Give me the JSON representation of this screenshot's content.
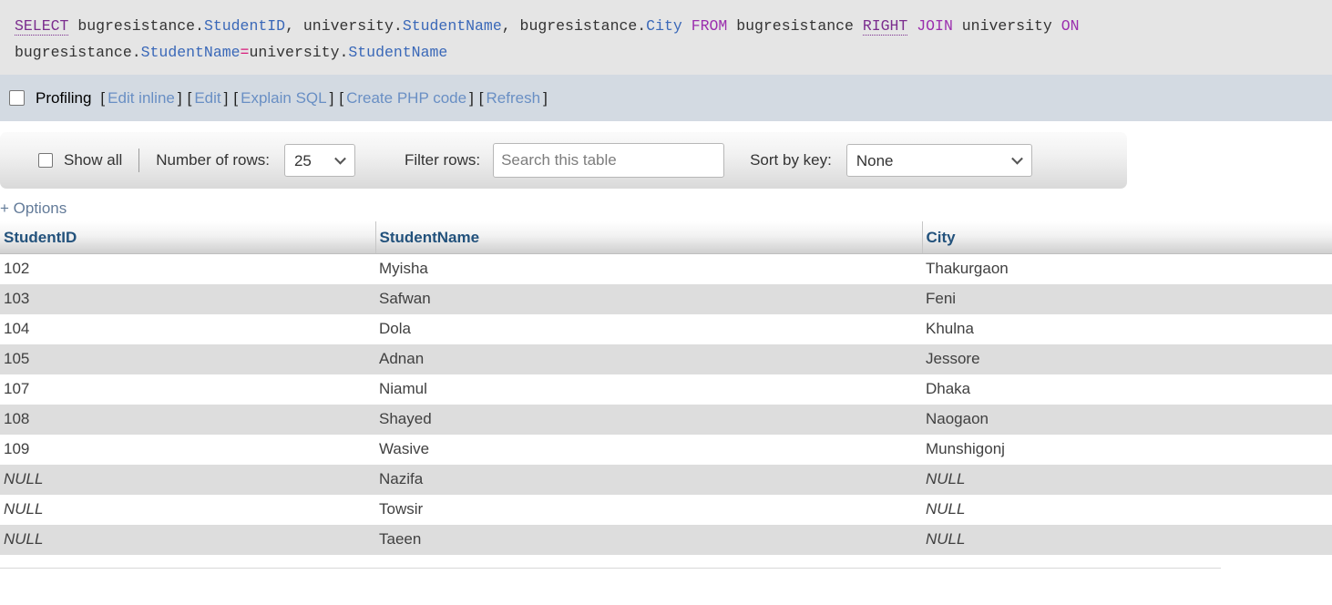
{
  "sql": {
    "tokens": [
      {
        "t": "SELECT",
        "k": "kw-u"
      },
      {
        "t": " ",
        "k": "plain"
      },
      {
        "t": "bugresistance.",
        "k": "plain"
      },
      {
        "t": "StudentID",
        "k": "col"
      },
      {
        "t": ", ",
        "k": "plain"
      },
      {
        "t": "university.",
        "k": "plain"
      },
      {
        "t": "StudentName",
        "k": "col"
      },
      {
        "t": ", ",
        "k": "plain"
      },
      {
        "t": "bugresistance.",
        "k": "plain"
      },
      {
        "t": "City",
        "k": "col"
      },
      {
        "t": " ",
        "k": "plain"
      },
      {
        "t": "FROM",
        "k": "kw"
      },
      {
        "t": " bugresistance ",
        "k": "plain"
      },
      {
        "t": "RIGHT",
        "k": "kw-u"
      },
      {
        "t": " ",
        "k": "plain"
      },
      {
        "t": "JOIN",
        "k": "kw"
      },
      {
        "t": " university ",
        "k": "plain"
      },
      {
        "t": "ON",
        "k": "kw"
      },
      {
        "t": " ",
        "k": "plain"
      },
      {
        "t": "bugresistance.",
        "k": "plain"
      },
      {
        "t": "StudentName",
        "k": "col"
      },
      {
        "t": "=",
        "k": "op"
      },
      {
        "t": "university.",
        "k": "plain"
      },
      {
        "t": "StudentName",
        "k": "col"
      }
    ],
    "full_text": "SELECT bugresistance.StudentID, university.StudentName, bugresistance.City FROM bugresistance RIGHT JOIN university ON bugresistance.StudentName=university.StudentName"
  },
  "profiling": {
    "checkbox_checked": false,
    "label": "Profiling",
    "links": [
      {
        "label": "Edit inline"
      },
      {
        "label": "Edit"
      },
      {
        "label": "Explain SQL"
      },
      {
        "label": "Create PHP code"
      },
      {
        "label": "Refresh"
      }
    ],
    "open_bracket": "[",
    "close_bracket": "]"
  },
  "toolbar": {
    "show_all_label": "Show all",
    "show_all_checked": false,
    "number_of_rows_label": "Number of rows:",
    "number_of_rows_value": "25",
    "number_of_rows_options": [
      "25"
    ],
    "filter_rows_label": "Filter rows:",
    "filter_rows_value": "",
    "filter_rows_placeholder": "Search this table",
    "sort_by_key_label": "Sort by key:",
    "sort_by_key_value": "None",
    "sort_by_key_options": [
      "None"
    ]
  },
  "options_link": "+ Options",
  "table": {
    "columns": [
      "StudentID",
      "StudentName",
      "City"
    ],
    "rows": [
      {
        "StudentID": "102",
        "StudentName": "Myisha",
        "City": "Thakurgaon",
        "id_null": false,
        "city_null": false
      },
      {
        "StudentID": "103",
        "StudentName": "Safwan",
        "City": "Feni",
        "id_null": false,
        "city_null": false
      },
      {
        "StudentID": "104",
        "StudentName": "Dola",
        "City": "Khulna",
        "id_null": false,
        "city_null": false
      },
      {
        "StudentID": "105",
        "StudentName": "Adnan",
        "City": "Jessore",
        "id_null": false,
        "city_null": false
      },
      {
        "StudentID": "107",
        "StudentName": "Niamul",
        "City": "Dhaka",
        "id_null": false,
        "city_null": false
      },
      {
        "StudentID": "108",
        "StudentName": "Shayed",
        "City": "Naogaon",
        "id_null": false,
        "city_null": false
      },
      {
        "StudentID": "109",
        "StudentName": "Wasive",
        "City": "Munshigonj",
        "id_null": false,
        "city_null": false
      },
      {
        "StudentID": "NULL",
        "StudentName": "Nazifa",
        "City": "NULL",
        "id_null": true,
        "city_null": true
      },
      {
        "StudentID": "NULL",
        "StudentName": "Towsir",
        "City": "NULL",
        "id_null": true,
        "city_null": true
      },
      {
        "StudentID": "NULL",
        "StudentName": "Taeen",
        "City": "NULL",
        "id_null": true,
        "city_null": true
      }
    ]
  },
  "colors": {
    "sql_box_bg": "#e5e5e5",
    "profiling_bar_bg": "#d3dae2",
    "link_blue": "#698fc4",
    "header_text": "#23527c",
    "keyword_purple": "#9b2fae",
    "column_blue": "#3a68b8",
    "operator_pink": "#d81b7a",
    "row_even_bg": "#dddddd",
    "row_odd_bg": "#ffffff"
  }
}
